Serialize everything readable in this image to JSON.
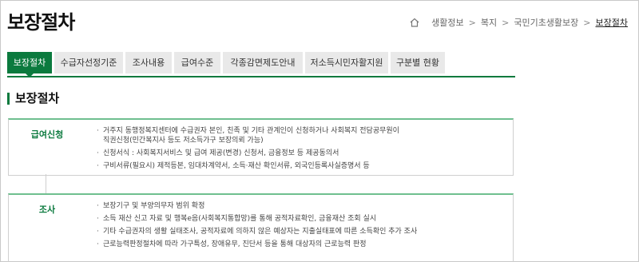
{
  "page": {
    "title": "보장절차"
  },
  "breadcrumb": {
    "items": [
      "생활정보",
      "복지",
      "국민기초생활보장",
      "보장절차"
    ],
    "separator": ">"
  },
  "tabs": [
    {
      "label": "보장절차",
      "active": true
    },
    {
      "label": "수급자선정기준",
      "active": false
    },
    {
      "label": "조사내용",
      "active": false
    },
    {
      "label": "급여수준",
      "active": false
    },
    {
      "label": "각종감면제도안내",
      "active": false
    },
    {
      "label": "저소득시민자활지원",
      "active": false
    },
    {
      "label": "구분별 현황",
      "active": false
    }
  ],
  "section": {
    "title": "보장절차"
  },
  "steps": [
    {
      "head": "급여신청",
      "items": [
        {
          "line1": "거주지 동행정복지센터에 수급권자 본인, 친족 및 기타 관계인이 신청하거나 사회복지 전담공무원이",
          "line2": "직권신청(민간복지사 등도 저소득가구 보장의뢰 가능)"
        },
        {
          "line1": "신청서식 : 사회복지서비스 및 급여 제공(변경) 신청서, 금융정보 등 제공동의서"
        },
        {
          "line1": "구비서류(필요시) 제적등본, 임대차계약서, 소득·재산 확인서류, 외국인등록사실증명서 등"
        }
      ]
    },
    {
      "head": "조사",
      "items": [
        {
          "line1": "보장기구 및 부양의무자 범위 확정"
        },
        {
          "line1": "소득 재산 신고 자료 및 행복e음(사회복지통합망)를 통해 공적자료확인, 금융재산 조회 실시"
        },
        {
          "line1": "기타 수급권자의 생활 실태조사, 공적자료에 의하지 않은 예상자는 지출실태표에 따른 소득확인 추가 조사"
        },
        {
          "line1": "근로능력판정절차에 따라 가구특성, 장애유무, 진단서 등을 통해 대상자의 근로능력 판정"
        }
      ]
    }
  ],
  "colors": {
    "accent": "#0b7a3e",
    "tab_bg": "#e9e9e9",
    "box_top": "#6fbf8f"
  },
  "icons": {
    "home": "home-icon"
  }
}
